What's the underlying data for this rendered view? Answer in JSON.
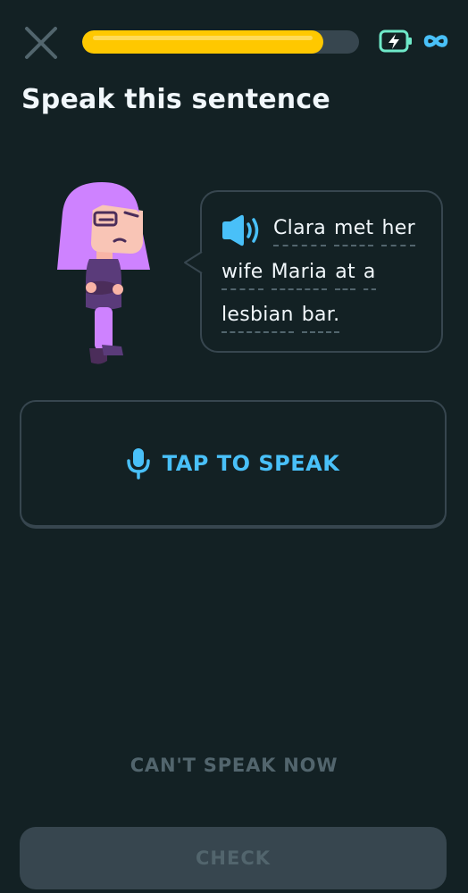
{
  "header": {
    "progress_percent": 87,
    "energy": "infinite"
  },
  "prompt": {
    "title": "Speak this sentence"
  },
  "sentence": {
    "lines": [
      [
        "Clara",
        "met",
        "her"
      ],
      [
        "wife",
        "Maria",
        "at",
        "a"
      ],
      [
        "lesbian",
        "bar."
      ]
    ]
  },
  "actions": {
    "tap_to_speak": "TAP TO SPEAK",
    "cant_speak_now": "CAN'T SPEAK NOW",
    "check": "CHECK"
  },
  "colors": {
    "background": "#132124",
    "progress_fill": "#ffc800",
    "accent_blue": "#49c0f8",
    "character_purple": "#ce82ff",
    "disabled_gray": "#52656d",
    "border": "#37464f"
  },
  "icons": {
    "close": "close-icon",
    "energy": "battery-bolt-icon",
    "infinity": "infinity-icon",
    "speaker": "speaker-icon",
    "microphone": "microphone-icon"
  }
}
